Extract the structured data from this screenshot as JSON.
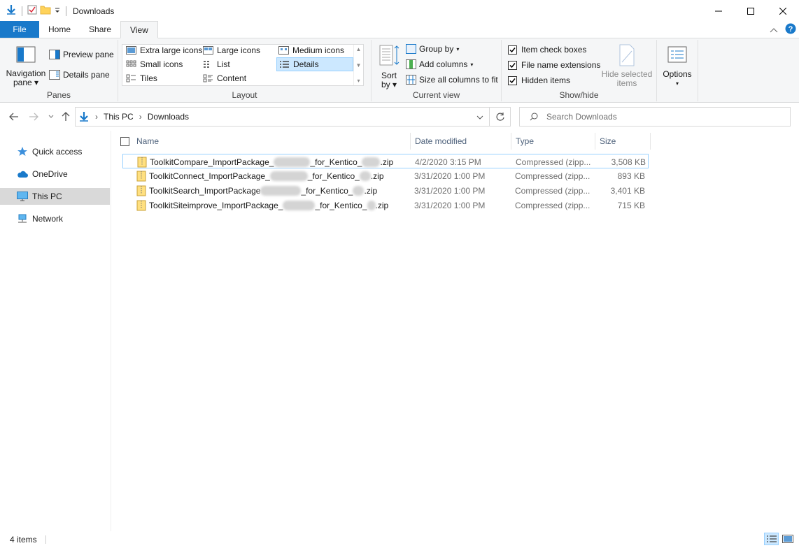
{
  "window": {
    "title": "Downloads"
  },
  "ribbon_tabs": [
    "File",
    "Home",
    "Share",
    "View"
  ],
  "panes": {
    "navigation_pane": "Navigation",
    "navigation_pane_sub": "pane",
    "preview_pane": "Preview pane",
    "details_pane": "Details pane",
    "group_label": "Panes"
  },
  "layout": {
    "items": [
      "Extra large icons",
      "Large icons",
      "Medium icons",
      "Small icons",
      "List",
      "Details",
      "Tiles",
      "Content"
    ],
    "selected": "Details",
    "group_label": "Layout"
  },
  "current_view": {
    "sort": "Sort",
    "sort_sub": "by",
    "group_by": "Group by",
    "add_columns": "Add columns",
    "size_all_columns": "Size all columns to fit",
    "group_label": "Current view"
  },
  "show_hide": {
    "item_check_boxes": "Item check boxes",
    "file_name_extensions": "File name extensions",
    "hidden_items": "Hidden items",
    "hide_selected": "Hide selected",
    "hide_selected_sub": "items",
    "group_label": "Show/hide"
  },
  "options": {
    "label": "Options"
  },
  "address": {
    "crumbs": [
      "This PC",
      "Downloads"
    ]
  },
  "search": {
    "placeholder": "Search Downloads"
  },
  "nav_pane": {
    "items": [
      "Quick access",
      "OneDrive",
      "This PC",
      "Network"
    ],
    "selected": "This PC"
  },
  "columns": [
    "Name",
    "Date modified",
    "Type",
    "Size"
  ],
  "files": [
    {
      "name_a": "ToolkitCompare_ImportPackage_",
      "name_b": "_for_Kentico_",
      "name_c": ".zip",
      "date": "4/2/2020 3:15 PM",
      "type": "Compressed (zipp...",
      "size": "3,508 KB"
    },
    {
      "name_a": "ToolkitConnect_ImportPackage_",
      "name_b": "_for_Kentico_",
      "name_c": ".zip",
      "date": "3/31/2020 1:00 PM",
      "type": "Compressed (zipp...",
      "size": "893 KB"
    },
    {
      "name_a": "ToolkitSearch_ImportPackage",
      "name_b": "_for_Kentico_",
      "name_c": ".zip",
      "date": "3/31/2020 1:00 PM",
      "type": "Compressed (zipp...",
      "size": "3,401 KB"
    },
    {
      "name_a": "ToolkitSiteimprove_ImportPackage_",
      "name_b": "_for_Kentico_",
      "name_c": ".zip",
      "date": "3/31/2020 1:00 PM",
      "type": "Compressed (zipp...",
      "size": "715 KB"
    }
  ],
  "status": {
    "item_count": "4 items"
  },
  "colors": {
    "accent": "#1979ca",
    "selection": "#cce8ff",
    "selection_border": "#99d1ff"
  }
}
